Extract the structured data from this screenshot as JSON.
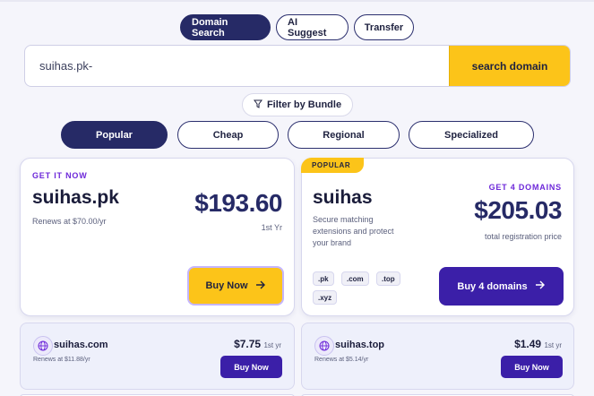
{
  "mode_tabs": [
    "Domain Search",
    "AI Suggest",
    "Transfer"
  ],
  "search": {
    "value": "suihas.pk-",
    "button_label": "search domain"
  },
  "filter": {
    "label": "Filter by Bundle"
  },
  "bundle_tabs": [
    "Popular",
    "Cheap",
    "Regional",
    "Specialized"
  ],
  "card_single": {
    "eyebrow": "GET IT NOW",
    "domain": "suihas.pk",
    "renew": "Renews at $70.00/yr",
    "price": "$193.60",
    "period": "1st Yr",
    "button_label": "Buy Now"
  },
  "card_bundle": {
    "badge": "POPULAR",
    "eyebrow": "GET 4 DOMAINS",
    "name": "suihas",
    "description": "Secure matching extensions and protect your brand",
    "price": "$205.03",
    "price_note": "total registration price",
    "tlds": [
      ".pk",
      ".com",
      ".top",
      ".xyz"
    ],
    "button_label": "Buy 4 domains"
  },
  "mini_cards": [
    {
      "domain": "suihas.com",
      "renew": "Renews at $11.88/yr",
      "price": "$7.75",
      "period": "1st yr",
      "button_label": "Buy Now"
    },
    {
      "domain": "suihas.top",
      "renew": "Renews at $5.14/yr",
      "price": "$1.49",
      "period": "1st yr",
      "button_label": "Buy Now"
    }
  ],
  "colors": {
    "navy": "#262a66",
    "yellow": "#fcc419",
    "purple": "#3b1fa8",
    "eyebrow": "#6d28d9"
  },
  "icons": [
    "filter-icon",
    "arrow-right-icon",
    "globe-icon"
  ]
}
